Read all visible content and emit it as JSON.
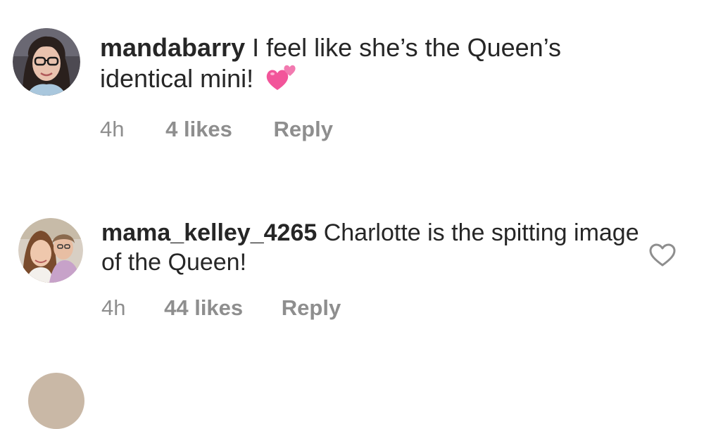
{
  "comments": [
    {
      "username": "mandabarry",
      "text": "I feel like she’s the Queen’s identical mini!",
      "emoji_icon": "two-hearts-icon",
      "time": "4h",
      "likes": "4 likes",
      "reply_label": "Reply"
    },
    {
      "username": "mama_kelley_4265",
      "text": "Charlotte is the spitting image of the Queen!",
      "time": "4h",
      "likes": "44 likes",
      "reply_label": "Reply",
      "like_icon": "heart-outline-icon"
    }
  ],
  "colors": {
    "text": "#262626",
    "meta": "#8e8e8e",
    "emoji_pink": "#f2559a"
  }
}
